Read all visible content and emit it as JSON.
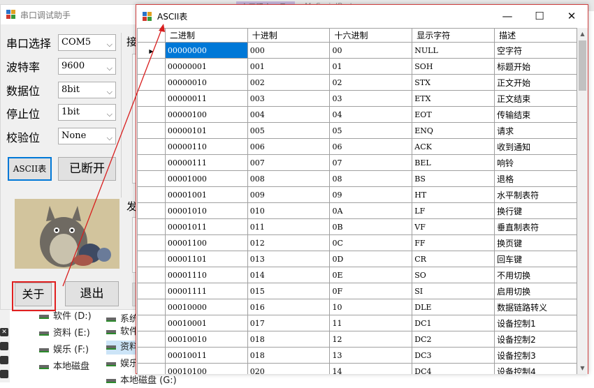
{
  "background": {
    "top_tabs": [
      "应用程序工具",
      "MySerialPort"
    ],
    "drives_col1": [
      "软件 (D:)",
      "资料 (E:)",
      "娱乐 (F:)",
      "本地磁盘"
    ],
    "drives_col2": [
      "系统",
      "软件",
      "资料",
      "娱乐",
      "本地磁盘 (G:)"
    ]
  },
  "serial_assistant": {
    "title": "串口调试助手",
    "labels": {
      "port": "串口选择",
      "baud": "波特率",
      "databits": "数据位",
      "stopbits": "停止位",
      "parity": "校验位"
    },
    "values": {
      "port": "COM5",
      "baud": "9600",
      "databits": "8bit",
      "stopbits": "1bit",
      "parity": "None"
    },
    "buttons": {
      "ascii": "ASCII表",
      "open": "已断开",
      "about": "关于",
      "exit": "退出"
    },
    "partial_labels": [
      "接",
      "发"
    ]
  },
  "ascii_window": {
    "title": "ASCII表",
    "controls": {
      "minimize": "—",
      "maximize": "☐",
      "close": "✕"
    },
    "columns": [
      "二进制",
      "十进制",
      "十六进制",
      "显示字符",
      "描述"
    ],
    "selected_row": 0,
    "rows": [
      [
        "00000000",
        "000",
        "00",
        "NULL",
        "空字符"
      ],
      [
        "00000001",
        "001",
        "01",
        "SOH",
        "标题开始"
      ],
      [
        "00000010",
        "002",
        "02",
        "STX",
        "正文开始"
      ],
      [
        "00000011",
        "003",
        "03",
        "ETX",
        "正文结束"
      ],
      [
        "00000100",
        "004",
        "04",
        "EOT",
        "传输结束"
      ],
      [
        "00000101",
        "005",
        "05",
        "ENQ",
        "请求"
      ],
      [
        "00000110",
        "006",
        "06",
        "ACK",
        "收到通知"
      ],
      [
        "00000111",
        "007",
        "07",
        "BEL",
        "响铃"
      ],
      [
        "00001000",
        "008",
        "08",
        "BS",
        "退格"
      ],
      [
        "00001001",
        "009",
        "09",
        "HT",
        "水平制表符"
      ],
      [
        "00001010",
        "010",
        "0A",
        "LF",
        "换行键"
      ],
      [
        "00001011",
        "011",
        "0B",
        "VF",
        "垂直制表符"
      ],
      [
        "00001100",
        "012",
        "0C",
        "FF",
        "换页键"
      ],
      [
        "00001101",
        "013",
        "0D",
        "CR",
        "回车键"
      ],
      [
        "00001110",
        "014",
        "0E",
        "SO",
        "不用切换"
      ],
      [
        "00001111",
        "015",
        "0F",
        "SI",
        "启用切换"
      ],
      [
        "00010000",
        "016",
        "10",
        "DLE",
        "数据链路转义"
      ],
      [
        "00010001",
        "017",
        "11",
        "DC1",
        "设备控制1"
      ],
      [
        "00010010",
        "018",
        "12",
        "DC2",
        "设备控制2"
      ],
      [
        "00010011",
        "018",
        "13",
        "DC3",
        "设备控制3"
      ],
      [
        "00010100",
        "020",
        "14",
        "DC4",
        "设备控制4"
      ]
    ]
  },
  "colors": {
    "selection": "#0078d7",
    "annotation": "#e02020"
  }
}
